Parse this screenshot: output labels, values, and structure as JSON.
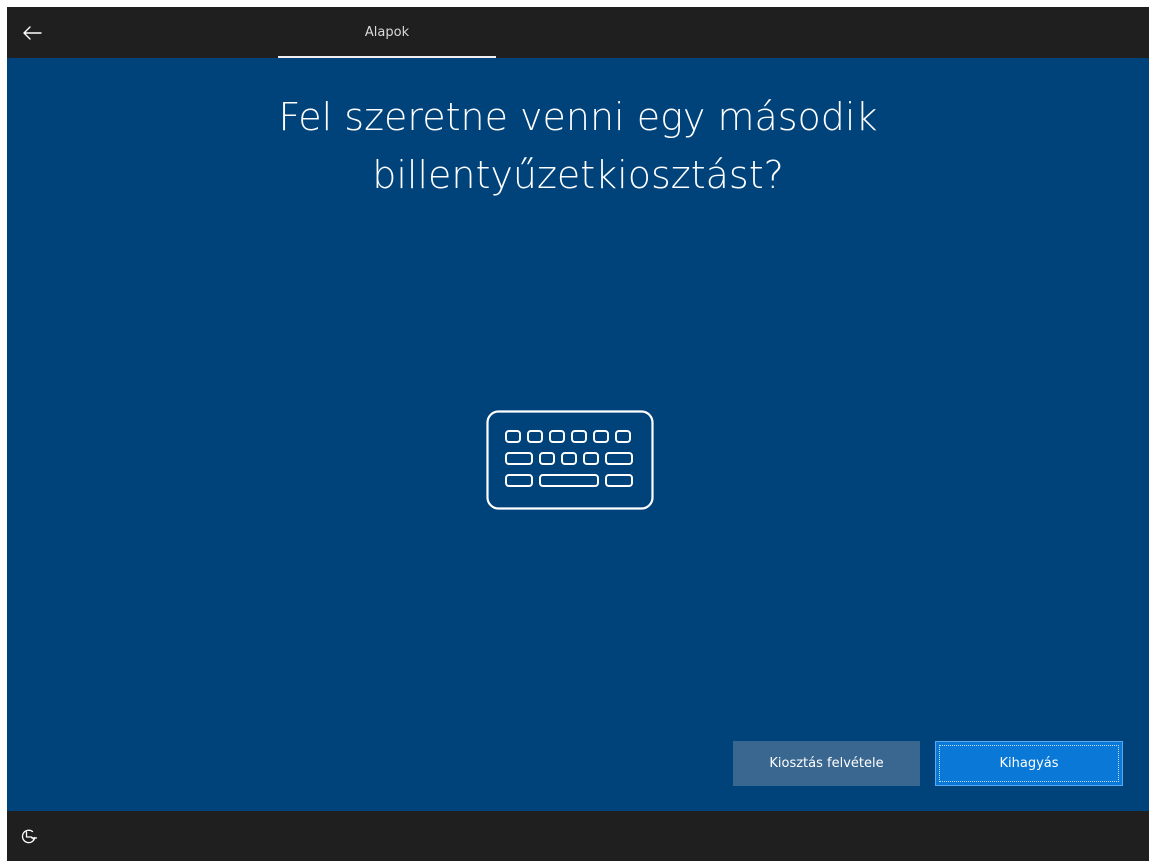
{
  "header": {
    "back_icon": "arrow-left-icon",
    "tab_label": "Alapok"
  },
  "main": {
    "title_line1": "Fel szeretne venni egy második",
    "title_line2": "billentyűzetkiosztást?",
    "illustration_icon": "keyboard-icon"
  },
  "actions": {
    "add_layout_label": "Kiosztás felvétele",
    "skip_label": "Kihagyás"
  },
  "footer": {
    "accessibility_icon": "ease-of-access-icon"
  },
  "colors": {
    "background": "#00427a",
    "bar": "#1f1f1f",
    "primary_button": "#0a78d6",
    "secondary_button": "#3a6790"
  }
}
